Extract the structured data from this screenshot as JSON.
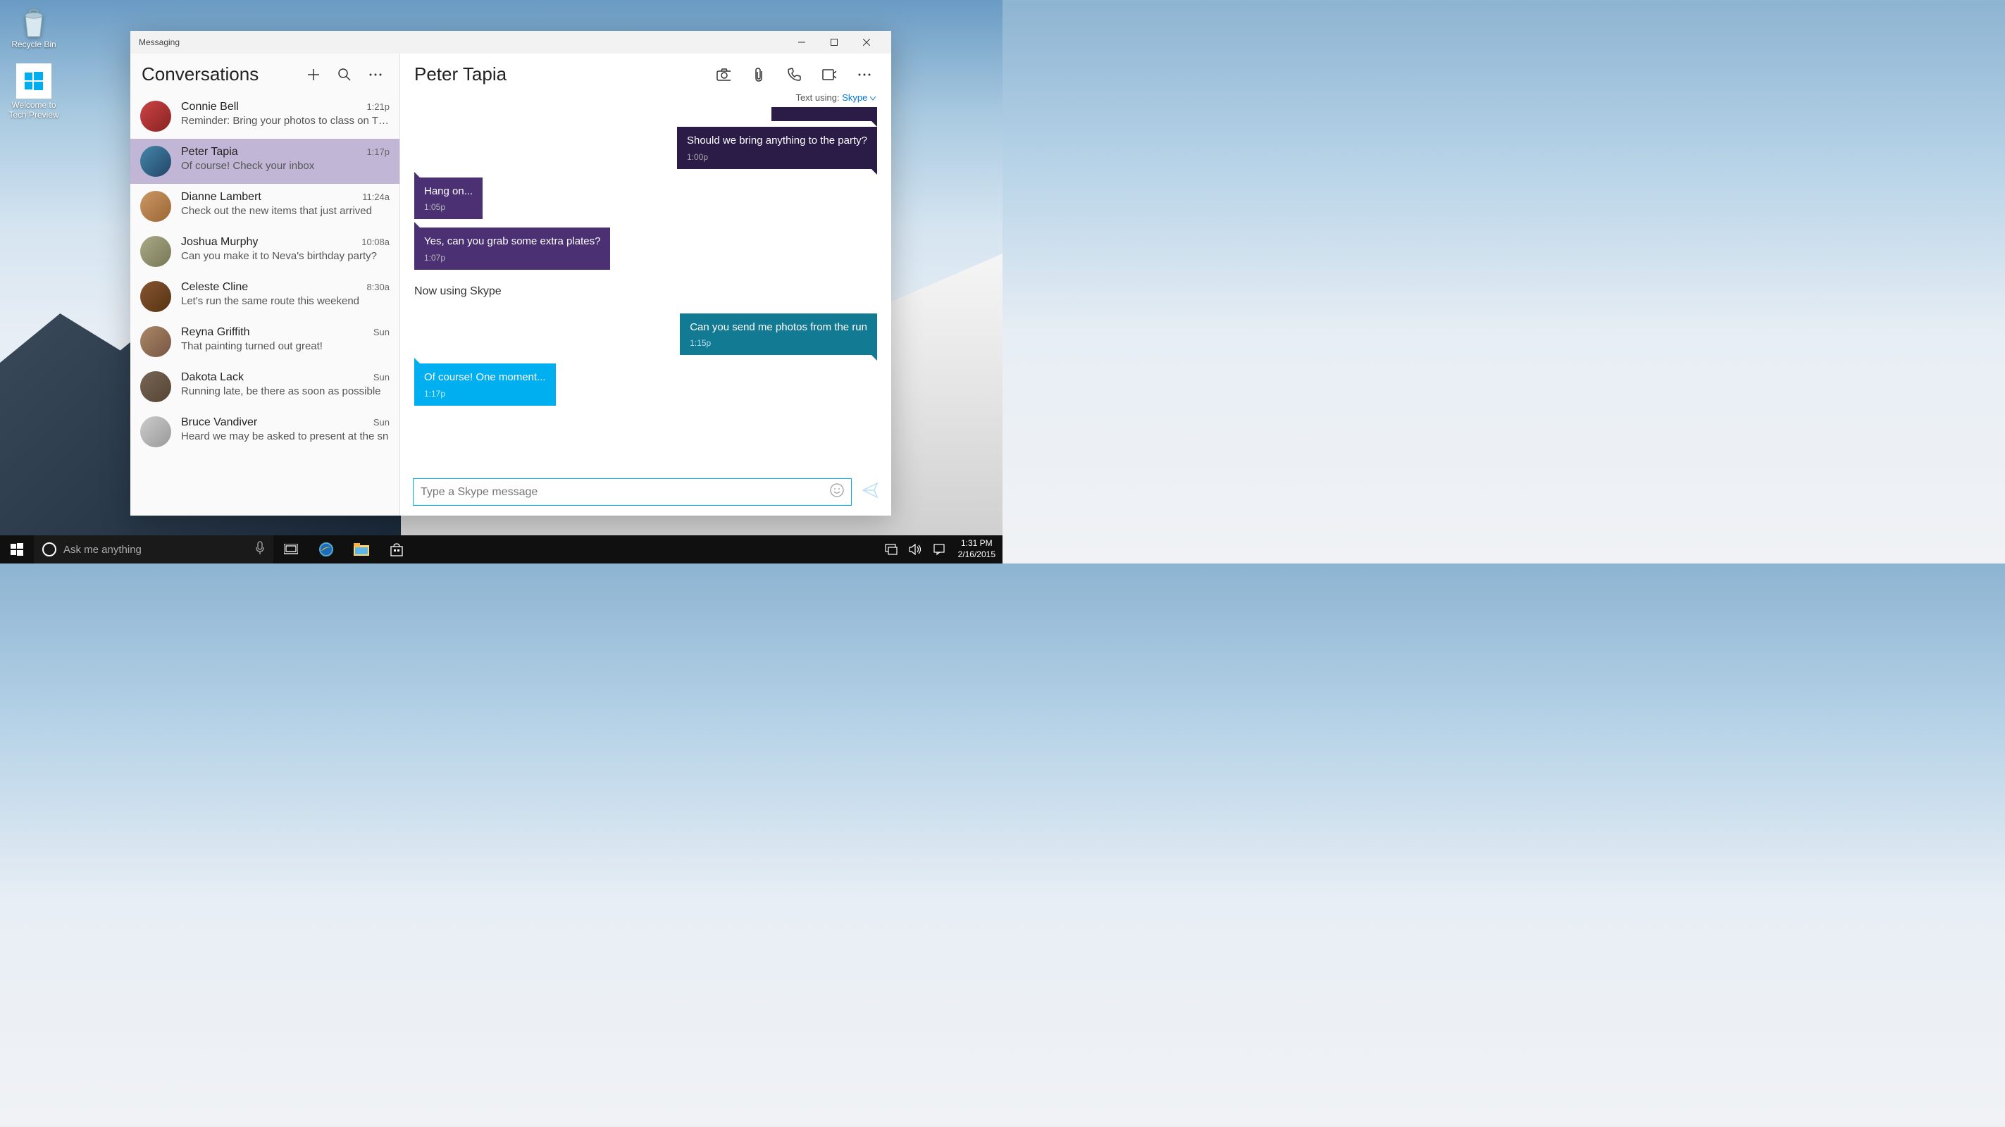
{
  "desktop": {
    "icons": [
      {
        "label": "Recycle Bin",
        "type": "recycle-bin"
      },
      {
        "label": "Welcome to\nTech Preview",
        "type": "tech-preview"
      }
    ]
  },
  "app": {
    "title": "Messaging",
    "sidebar": {
      "title": "Conversations"
    },
    "conversations": [
      {
        "name": "Connie Bell",
        "time": "1:21p",
        "preview": "Reminder: Bring your photos to class on Thu",
        "selected": false
      },
      {
        "name": "Peter Tapia",
        "time": "1:17p",
        "preview": "Of course! Check your inbox",
        "selected": true
      },
      {
        "name": "Dianne Lambert",
        "time": "11:24a",
        "preview": "Check out the new items that just arrived",
        "selected": false
      },
      {
        "name": "Joshua Murphy",
        "time": "10:08a",
        "preview": "Can you make it to Neva's birthday party?",
        "selected": false
      },
      {
        "name": "Celeste Cline",
        "time": "8:30a",
        "preview": "Let's run the same route this weekend",
        "selected": false
      },
      {
        "name": "Reyna Griffith",
        "time": "Sun",
        "preview": "That painting turned out great!",
        "selected": false
      },
      {
        "name": "Dakota Lack",
        "time": "Sun",
        "preview": "Running late, be there as soon as possible",
        "selected": false
      },
      {
        "name": "Bruce Vandiver",
        "time": "Sun",
        "preview": "Heard we may be asked to present at the sn",
        "selected": false
      }
    ],
    "chat": {
      "contact": "Peter Tapia",
      "text_using_label": "Text using:",
      "text_using_service": "Skype",
      "system_message": "Now using Skype",
      "messages": [
        {
          "dir": "out",
          "style": "purple-dark",
          "text": "Should we bring anything to the party?",
          "time": "1:00p"
        },
        {
          "dir": "in",
          "style": "purple",
          "text": "Hang on...",
          "time": "1:05p"
        },
        {
          "dir": "in",
          "style": "purple",
          "text": "Yes, can you grab some extra plates?",
          "time": "1:07p"
        },
        {
          "dir": "out",
          "style": "teal",
          "text": "Can you send me photos from the run",
          "time": "1:15p"
        },
        {
          "dir": "in",
          "style": "skype",
          "text": "Of course!  One moment...",
          "time": "1:17p"
        }
      ],
      "compose_placeholder": "Type a Skype message"
    }
  },
  "taskbar": {
    "search_placeholder": "Ask me anything",
    "clock_time": "1:31 PM",
    "clock_date": "2/16/2015"
  }
}
